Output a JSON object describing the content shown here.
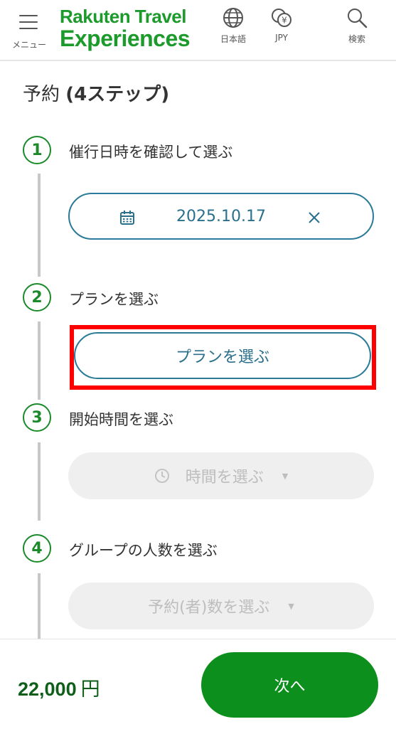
{
  "header": {
    "menu_label": "メニュー",
    "logo_line1": "Rakuten Travel",
    "logo_line2": "Experiences",
    "language_label": "日本語",
    "currency_label": "JPY",
    "search_label": "検索"
  },
  "main": {
    "title_prefix": "予約 ",
    "title_steps": "(4ステップ)",
    "steps": [
      {
        "number": "1",
        "label": "催行日時を確認して選ぶ",
        "value": "2025.10.17"
      },
      {
        "number": "2",
        "label": "プランを選ぶ",
        "value": "プランを選ぶ"
      },
      {
        "number": "3",
        "label": "開始時間を選ぶ",
        "value": "時間を選ぶ"
      },
      {
        "number": "4",
        "label": "グループの人数を選ぶ",
        "value": "予約(者)数を選ぶ"
      }
    ]
  },
  "footer": {
    "price": "22,000",
    "currency": "円",
    "next_label": "次へ"
  },
  "colors": {
    "brand_green": "#1d9a2c",
    "button_green": "#0c8f1c",
    "accent_teal": "#2a7a98",
    "highlight_red": "#ff0000"
  }
}
